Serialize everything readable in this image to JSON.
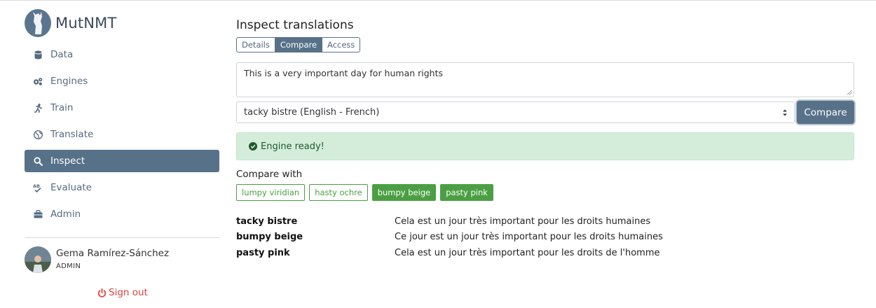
{
  "brand": {
    "name": "MutNMT"
  },
  "nav": [
    {
      "label": "Data",
      "icon": "database-icon",
      "active": false
    },
    {
      "label": "Engines",
      "icon": "cogs-icon",
      "active": false
    },
    {
      "label": "Train",
      "icon": "running-icon",
      "active": false
    },
    {
      "label": "Translate",
      "icon": "globe-icon",
      "active": false
    },
    {
      "label": "Inspect",
      "icon": "search-icon",
      "active": true
    },
    {
      "label": "Evaluate",
      "icon": "spellcheck-icon",
      "active": false
    },
    {
      "label": "Admin",
      "icon": "toolbox-icon",
      "active": false
    }
  ],
  "user": {
    "name": "Gema Ramírez-Sánchez",
    "role": "ADMIN"
  },
  "signout": {
    "label": "Sign out"
  },
  "main": {
    "title": "Inspect translations",
    "tabs": [
      {
        "label": "Details",
        "active": false
      },
      {
        "label": "Compare",
        "active": true
      },
      {
        "label": "Access",
        "active": false
      }
    ],
    "source_text": "This is a very important day for human rights",
    "engine_select": "tacky bistre (English - French)",
    "compare_button": "Compare",
    "alert": "Engine ready!",
    "compare_with_label": "Compare with",
    "chips": [
      {
        "label": "lumpy viridian",
        "selected": false
      },
      {
        "label": "hasty ochre",
        "selected": false
      },
      {
        "label": "bumpy beige",
        "selected": true
      },
      {
        "label": "pasty pink",
        "selected": true
      }
    ],
    "results": [
      {
        "engine": "tacky bistre",
        "translation": "Cela est un jour très important pour les droits humaines"
      },
      {
        "engine": "bumpy beige",
        "translation": "Ce jour est un jour très important pour les droits humaines"
      },
      {
        "engine": "pasty pink",
        "translation": "Cela est un jour très important pour les droits de l'homme"
      }
    ]
  },
  "colors": {
    "primary": "#577189",
    "success": "#4a9f43",
    "alert_bg": "#d4eddb",
    "danger": "#d9433b"
  }
}
